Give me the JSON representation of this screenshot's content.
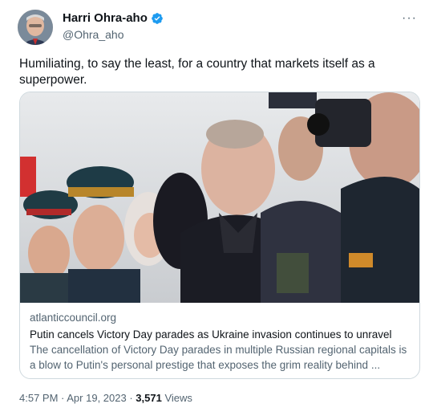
{
  "author": {
    "display_name": "Harri Ohra-aho",
    "handle": "@Ohra_aho"
  },
  "more_label": "···",
  "tweet_text": "Humiliating, to say the least, for a country that markets itself as a superpower.",
  "card": {
    "domain": "atlanticcouncil.org",
    "title": "Putin cancels Victory Day parades as Ukraine invasion continues to unravel",
    "description_line1": "The cancellation of Victory Day parades in multiple Russian regional capitals is",
    "description_line2": "a blow to Putin's personal prestige that exposes the grim reality behind ..."
  },
  "meta": {
    "time": "4:57 PM",
    "separator1": " · ",
    "date": "Apr 19, 2023",
    "separator2": " · ",
    "views_count": "3,571",
    "views_label": " Views"
  },
  "colors": {
    "verified_blue": "#1d9bf0",
    "secondary_text": "#536471",
    "border": "#cfd9de"
  },
  "icons": [
    "verified-badge-icon",
    "more-options-icon"
  ]
}
